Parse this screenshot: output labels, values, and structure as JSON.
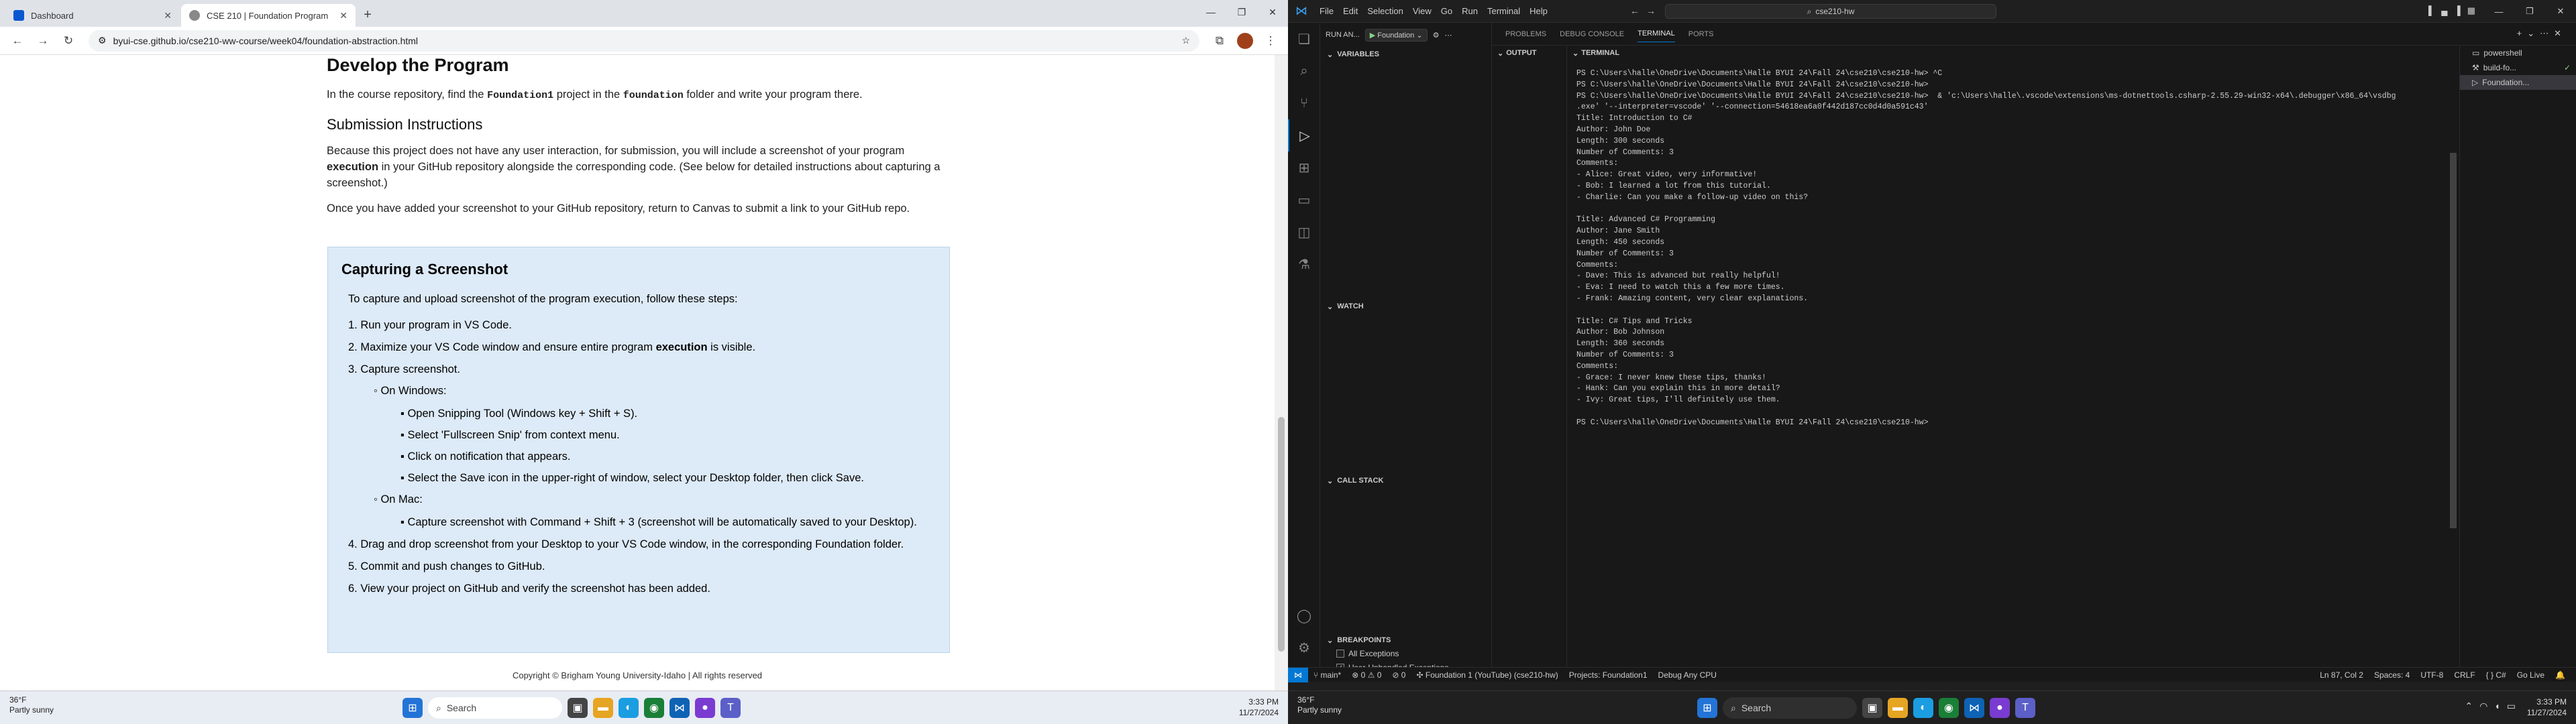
{
  "browser": {
    "tabs": [
      {
        "label": "Dashboard"
      },
      {
        "label": "CSE 210 | Foundation Program"
      }
    ],
    "url": "byui-cse.github.io/cse210-ww-course/week04/foundation-abstraction.html"
  },
  "page": {
    "h_develop": "Develop the Program",
    "develop_p1": "In the course repository, find the ",
    "develop_code1": "Foundation1",
    "develop_p2": " project in the ",
    "develop_code2": "foundation",
    "develop_p3": " folder and write your program there.",
    "h_submission": "Submission Instructions",
    "sub_p1a": "Because this project does not have any user interaction, for submission, you will include a screenshot of your program ",
    "sub_p1b": "execution",
    "sub_p1c": " in your GitHub repository alongside the corresponding code. (See below for detailed instructions about capturing a screenshot.)",
    "sub_p2": "Once you have added your screenshot to your GitHub repository, return to Canvas to submit a link to your GitHub repo.",
    "box": {
      "title": "Capturing a Screenshot",
      "intro": "To capture and upload screenshot of the program execution, follow these steps:",
      "s1": "1. Run your program in VS Code.",
      "s2a": "2. Maximize your VS Code window and ensure entire program ",
      "s2b": "execution",
      "s2c": " is visible.",
      "s3": "3. Capture screenshot.",
      "windows": "On Windows:",
      "w1": "Open Snipping Tool (Windows key + Shift + S).",
      "w2": "Select 'Fullscreen Snip' from context menu.",
      "w3": "Click on notification that appears.",
      "w4": "Select the Save icon in the upper-right of window, select your Desktop folder, then click Save.",
      "mac": "On Mac:",
      "m1": "Capture screenshot with Command + Shift + 3 (screenshot will be automatically saved to your Desktop).",
      "s4": "4. Drag and drop screenshot from your Desktop to your VS Code window, in the corresponding Foundation folder.",
      "s5": "5. Commit and push changes to GitHub.",
      "s6": "6. View your project on GitHub and verify the screenshot has been added."
    },
    "footer": "Copyright © Brigham Young University-Idaho | All rights reserved"
  },
  "taskbar": {
    "temp": "36°F",
    "weather": "Partly sunny",
    "search": "Search",
    "time": "3:33 PM",
    "date": "11/27/2024"
  },
  "vscode": {
    "menu": [
      "File",
      "Edit",
      "Selection",
      "View",
      "Go",
      "Run",
      "Terminal",
      "Help"
    ],
    "command_center": "cse210-hw",
    "run_label": "RUN AN...",
    "run_config": "Foundation",
    "sections": {
      "variables": "VARIABLES",
      "watch": "WATCH",
      "call_stack": "CALL STACK",
      "breakpoints": "BREAKPOINTS"
    },
    "breakpoints": [
      "All Exceptions",
      "User-Unhandled Exceptions"
    ],
    "panel_tabs": [
      "PROBLEMS",
      "DEBUG CONSOLE",
      "TERMINAL",
      "PORTS"
    ],
    "output_header": "OUTPUT",
    "terminal_header": "TERMINAL",
    "terminal_lines": [
      "PS C:\\Users\\halle\\OneDrive\\Documents\\Halle BYUI 24\\Fall 24\\cse210\\cse210-hw> ^C",
      "PS C:\\Users\\halle\\OneDrive\\Documents\\Halle BYUI 24\\Fall 24\\cse210\\cse210-hw>",
      "PS C:\\Users\\halle\\OneDrive\\Documents\\Halle BYUI 24\\Fall 24\\cse210\\cse210-hw>  & 'c:\\Users\\halle\\.vscode\\extensions\\ms-dotnettools.csharp-2.55.29-win32-x64\\.debugger\\x86_64\\vsdbg",
      ".exe' '--interpreter=vscode' '--connection=54618ea6a0f442d187cc0d4d0a591c43'",
      "Title: Introduction to C#",
      "Author: John Doe",
      "Length: 300 seconds",
      "Number of Comments: 3",
      "Comments:",
      "- Alice: Great video, very informative!",
      "- Bob: I learned a lot from this tutorial.",
      "- Charlie: Can you make a follow-up video on this?",
      "",
      "Title: Advanced C# Programming",
      "Author: Jane Smith",
      "Length: 450 seconds",
      "Number of Comments: 3",
      "Comments:",
      "- Dave: This is advanced but really helpful!",
      "- Eva: I need to watch this a few more times.",
      "- Frank: Amazing content, very clear explanations.",
      "",
      "Title: C# Tips and Tricks",
      "Author: Bob Johnson",
      "Length: 360 seconds",
      "Number of Comments: 3",
      "Comments:",
      "- Grace: I never knew these tips, thanks!",
      "- Hank: Can you explain this in more detail?",
      "- Ivy: Great tips, I'll definitely use them.",
      "",
      "PS C:\\Users\\halle\\OneDrive\\Documents\\Halle BYUI 24\\Fall 24\\cse210\\cse210-hw>"
    ],
    "terminals": [
      "powershell",
      "build-fo...",
      "Foundation..."
    ],
    "status_left": [
      "main*",
      "0 ⚠ 0",
      "0",
      "Foundation 1 (YouTube) (cse210-hw)",
      "Projects: Foundation1",
      "Debug Any CPU"
    ],
    "status_right": [
      "Ln 87, Col 2",
      "Spaces: 4",
      "UTF-8",
      "CRLF",
      "{ } C#",
      "Go Live"
    ]
  },
  "colors": {
    "accent": "#0078d4",
    "box_bg": "#ddeaf7"
  }
}
